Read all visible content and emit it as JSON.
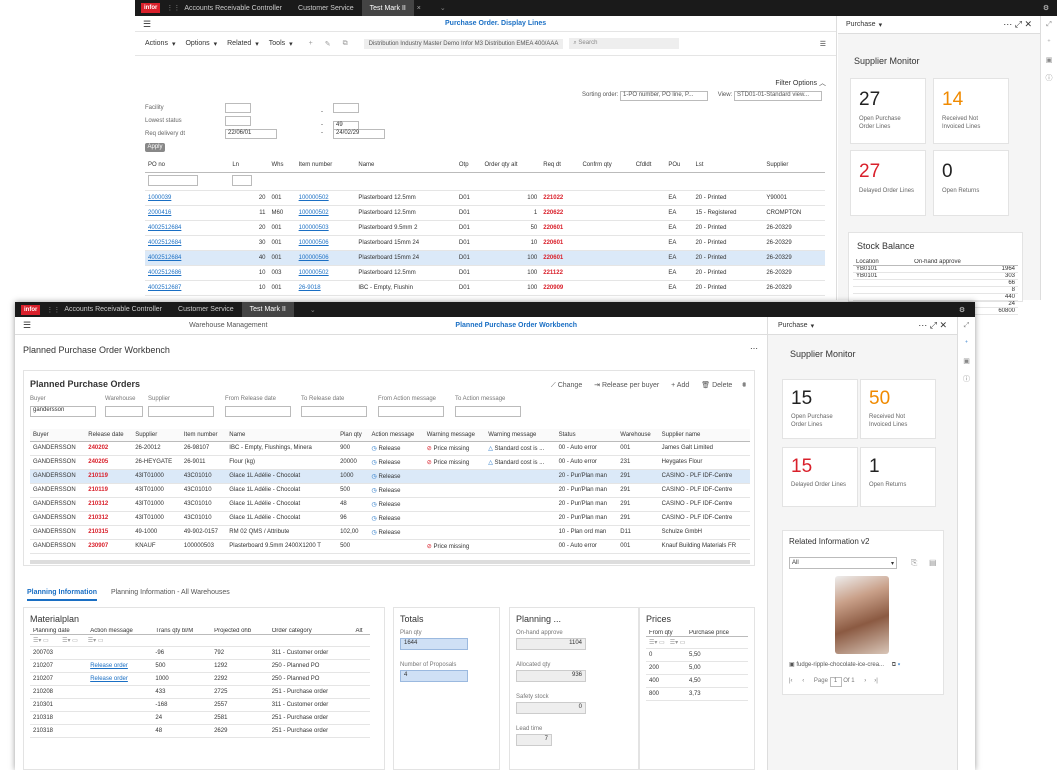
{
  "back": {
    "tabs": [
      "Accounts Receivable Controller",
      "Customer Service",
      "Test Mark II"
    ],
    "title": "Purchase Order. Display Lines",
    "toolbar": [
      "Actions",
      "Options",
      "Related",
      "Tools"
    ],
    "context": "Distribution Industry Master Demo Infor M3 Distribution EMEA 400/AAA",
    "search_placeholder": "Search",
    "filter_options": "Filter Options",
    "sorting_label": "Sorting order:",
    "sorting_value": "1-PO number, PO line, P...",
    "view_label": "View:",
    "view_value": "STD01-01-Standard view...",
    "filters": {
      "facility": "Facility",
      "lowest_status": "Lowest status",
      "req_delivery": "Req delivery dt",
      "date_from": "22/06/01",
      "date_to": "24/02/29",
      "status_to": "49",
      "apply": "Apply"
    },
    "columns": [
      "PO no",
      "Ln",
      "Whs",
      "Item number",
      "Name",
      "Otp",
      "Order qty alt",
      "Req dt",
      "Confrm qty",
      "Cfdldt",
      "POu",
      "Lst",
      "Supplier"
    ],
    "rows": [
      [
        "1000039",
        "20",
        "001",
        "100000502",
        "Plasterboard 12.5mm",
        "D01",
        "100",
        "221022",
        "",
        "",
        "EA",
        "20 - Printed",
        "Y90001"
      ],
      [
        "2000416",
        "11",
        "M60",
        "100000502",
        "Plasterboard 12.5mm",
        "D01",
        "1",
        "220622",
        "",
        "",
        "EA",
        "15 - Registered",
        "CROMPTON"
      ],
      [
        "4002512684",
        "20",
        "001",
        "100000503",
        "Plasterboard 9.5mm 2",
        "D01",
        "50",
        "220601",
        "",
        "",
        "EA",
        "20 - Printed",
        "26-20329"
      ],
      [
        "4002512684",
        "30",
        "001",
        "100000506",
        "Plasterboard 15mm 24",
        "D01",
        "10",
        "220601",
        "",
        "",
        "EA",
        "20 - Printed",
        "26-20329"
      ],
      [
        "4002512684",
        "40",
        "001",
        "100000506",
        "Plasterboard 15mm 24",
        "D01",
        "100",
        "220601",
        "",
        "",
        "EA",
        "20 - Printed",
        "26-20329"
      ],
      [
        "4002512686",
        "10",
        "003",
        "100000502",
        "Plasterboard 12.5mm",
        "D01",
        "100",
        "221122",
        "",
        "",
        "EA",
        "20 - Printed",
        "26-20329"
      ],
      [
        "4002512687",
        "10",
        "001",
        "26-9018",
        "IBC - Empty, Flushin",
        "D01",
        "100",
        "220909",
        "",
        "",
        "EA",
        "20 - Printed",
        "26-20329"
      ]
    ],
    "panel": {
      "header": "Purchase",
      "title": "Supplier Monitor",
      "kpis": [
        {
          "num": "27",
          "label": "Open Purchase Order Lines",
          "color": "#222"
        },
        {
          "num": "14",
          "label": "Received Not Invoiced Lines",
          "color": "#f08a00"
        },
        {
          "num": "27",
          "label": "Delayed Order Lines",
          "color": "#d9202b"
        },
        {
          "num": "0",
          "label": "Open Returns",
          "color": "#222"
        }
      ],
      "stock_title": "Stock Balance",
      "stock_cols": [
        "Location",
        "On-hand approve"
      ],
      "stock_rows": [
        [
          "YB0101",
          "1964"
        ],
        [
          "YB0101",
          "303"
        ],
        [
          "",
          "66"
        ],
        [
          "",
          "8"
        ],
        [
          "",
          "440"
        ],
        [
          "",
          "24"
        ],
        [
          "",
          "60800"
        ]
      ]
    }
  },
  "front": {
    "tabs": [
      "Accounts Receivable Controller",
      "Customer Service",
      "Test Mark II"
    ],
    "subtabs": [
      "Warehouse Management",
      "Planned Purchase Order Workbench"
    ],
    "page_title": "Planned Purchase Order Workbench",
    "section_title": "Planned Purchase Orders",
    "actions": [
      "Change",
      "Release per buyer",
      "Add",
      "Delete"
    ],
    "filter_labels": [
      "Buyer",
      "Warehouse",
      "Supplier",
      "From Release date",
      "To Release date",
      "From Action message",
      "To Action message"
    ],
    "buyer_value": "gandersson",
    "columns": [
      "Buyer",
      "Release date",
      "Supplier",
      "Item number",
      "Name",
      "Plan qty",
      "Action message",
      "Warning message",
      "Warning message",
      "Status",
      "Warehouse",
      "Supplier name"
    ],
    "rows": [
      [
        "GANDERSSON",
        "240202",
        "26-20012",
        "26-98107",
        "IBC - Empty, Flushings, Minera",
        "900",
        "Release",
        "Price missing",
        "Standard cost is ...",
        "00 - Auto error",
        "001",
        "James Galt Limited"
      ],
      [
        "GANDERSSON",
        "240205",
        "26-HEYGATE",
        "26-9011",
        "Flour (kg)",
        "20000",
        "Release",
        "Price missing",
        "Standard cost is ...",
        "00 - Auto error",
        "231",
        "Heygates Flour"
      ],
      [
        "GANDERSSON",
        "210119",
        "43IT01000",
        "43C01010",
        "Glace 1L Adélie - Chocolat",
        "1000",
        "Release",
        "",
        "",
        "20 - Pur/Plan man",
        "291",
        "CASINO - PLF IDF-Centre"
      ],
      [
        "GANDERSSON",
        "210119",
        "43IT01000",
        "43C01010",
        "Glace 1L Adélie - Chocolat",
        "500",
        "Release",
        "",
        "",
        "20 - Pur/Plan man",
        "291",
        "CASINO - PLF IDF-Centre"
      ],
      [
        "GANDERSSON",
        "210312",
        "43IT01000",
        "43C01010",
        "Glace 1L Adélie - Chocolat",
        "48",
        "Release",
        "",
        "",
        "20 - Pur/Plan man",
        "291",
        "CASINO - PLF IDF-Centre"
      ],
      [
        "GANDERSSON",
        "210312",
        "43IT01000",
        "43C01010",
        "Glace 1L Adélie - Chocolat",
        "96",
        "Release",
        "",
        "",
        "20 - Pur/Plan man",
        "291",
        "CASINO - PLF IDF-Centre"
      ],
      [
        "GANDERSSON",
        "210315",
        "49-1000",
        "49-902-0157",
        "RM 02 QMS / Attribute",
        "102,00",
        "Release",
        "",
        "",
        "10 - Plan ord man",
        "D11",
        "Schulze GmbH"
      ],
      [
        "GANDERSSON",
        "230907",
        "KNAUF",
        "100000503",
        "Plasterboard 9.5mm 2400X1200 T",
        "500",
        "",
        "Price missing",
        "",
        "00 - Auto error",
        "001",
        "Knauf Building Materials FR"
      ]
    ],
    "lower_tabs": [
      "Planning Information",
      "Planning Information - All Warehouses"
    ],
    "materialplan": {
      "title": "Materialplan",
      "columns": [
        "Planning date",
        "Action message",
        "Trans qty bl/M",
        "Projected ohb",
        "Order category",
        "Alt"
      ],
      "rows": [
        [
          "200703",
          "",
          "-96",
          "792",
          "311 - Customer order"
        ],
        [
          "210207",
          "Release order",
          "500",
          "1292",
          "250 - Planned PO"
        ],
        [
          "210207",
          "Release order",
          "1000",
          "2292",
          "250 - Planned PO"
        ],
        [
          "210208",
          "",
          "433",
          "2725",
          "251 - Purchase order"
        ],
        [
          "210301",
          "",
          "-168",
          "2557",
          "311 - Customer order"
        ],
        [
          "210318",
          "",
          "24",
          "2581",
          "251 - Purchase order"
        ],
        [
          "210318",
          "",
          "48",
          "2629",
          "251 - Purchase order"
        ]
      ]
    },
    "totals": {
      "title": "Totals",
      "plan_qty_label": "Plan qty",
      "plan_qty": "1644",
      "proposals_label": "Number of Proposals",
      "proposals": "4"
    },
    "planning": {
      "title": "Planning ...",
      "onhand_label": "On-hand approve",
      "onhand": "1104",
      "allocated_label": "Allocated qty",
      "allocated": "936",
      "safety_label": "Safety stock",
      "safety": "0",
      "lead_label": "Lead time",
      "lead": "7"
    },
    "prices": {
      "title": "Prices",
      "columns": [
        "From qty",
        "Purchase price"
      ],
      "rows": [
        [
          "0",
          "5,50"
        ],
        [
          "200",
          "5,00"
        ],
        [
          "400",
          "4,50"
        ],
        [
          "800",
          "3,73"
        ]
      ]
    },
    "panel": {
      "header": "Purchase",
      "title": "Supplier Monitor",
      "kpis": [
        {
          "num": "15",
          "label": "Open Purchase Order Lines",
          "color": "#222"
        },
        {
          "num": "50",
          "label": "Received Not Invoiced Lines",
          "color": "#f08a00"
        },
        {
          "num": "15",
          "label": "Delayed Order Lines",
          "color": "#d9202b"
        },
        {
          "num": "1",
          "label": "Open Returns",
          "color": "#222"
        }
      ],
      "related_title": "Related Information v2",
      "related_select": "All",
      "file_name": "fudge-ripple-chocolate-ice-crea...",
      "page_label": "Page",
      "page_num": "1",
      "page_of": "Of 1"
    }
  }
}
